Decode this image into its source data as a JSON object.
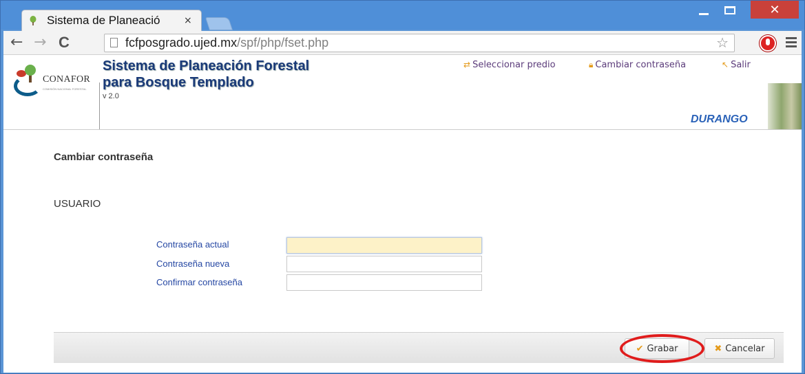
{
  "browser": {
    "tab_title": "Sistema de Planeació",
    "tab_close": "×",
    "url_host": "fcfposgrado.ujed.mx",
    "url_path": "/spf/php/fset.php",
    "back": "←",
    "forward": "→",
    "reload": "C",
    "star": "☆",
    "close_glyph": "✕"
  },
  "header": {
    "logo_text": "CONAFOR",
    "logo_subtext": "COMISIÓN NACIONAL FORESTAL",
    "title_line1": "Sistema de Planeación Forestal",
    "title_line2": "para Bosque Templado",
    "version": "v 2.0",
    "links": [
      {
        "label": "Seleccionar predio",
        "icon": "swap-icon"
      },
      {
        "label": "Cambiar contraseña",
        "icon": "lock-icon"
      },
      {
        "label": "Salir",
        "icon": "exit-arrow-icon"
      }
    ],
    "state": "DURANGO"
  },
  "form": {
    "title": "Cambiar contraseña",
    "user": "USUARIO",
    "fields": [
      {
        "label": "Contraseña actual",
        "value": ""
      },
      {
        "label": "Contraseña nueva",
        "value": ""
      },
      {
        "label": "Confirmar contraseña",
        "value": ""
      }
    ]
  },
  "actions": {
    "save_label": "Grabar",
    "cancel_label": "Cancelar",
    "highlight_color": "#e01c1c"
  }
}
